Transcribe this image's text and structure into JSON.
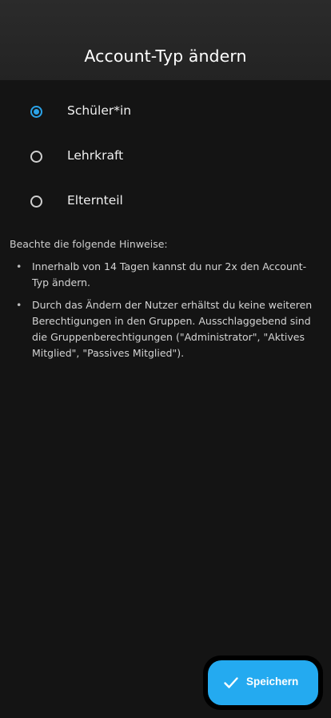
{
  "header": {
    "title": "Account-Typ ändern"
  },
  "account_type": {
    "options": [
      {
        "label": "Schüler*in",
        "selected": true
      },
      {
        "label": "Lehrkraft",
        "selected": false
      },
      {
        "label": "Elternteil",
        "selected": false
      }
    ]
  },
  "hints": {
    "heading": "Beachte die folgende Hinweise:",
    "bullet_symbol": "•",
    "items": [
      "Innerhalb von 14 Tagen kannst du nur 2x den Account-Typ ändern.",
      "Durch das Ändern der Nutzer erhältst du keine weiteren Berechtigungen in den Gruppen. Ausschlaggebend sind die Gruppenberechtigungen (\"Administrator\", \"Aktives Mitglied\", \"Passives Mitglied\")."
    ]
  },
  "save_button": {
    "label": "Speichern",
    "icon": "check-icon"
  },
  "colors": {
    "accent": "#24aaf0",
    "background": "#141414",
    "header_background": "#2b2b2b"
  }
}
